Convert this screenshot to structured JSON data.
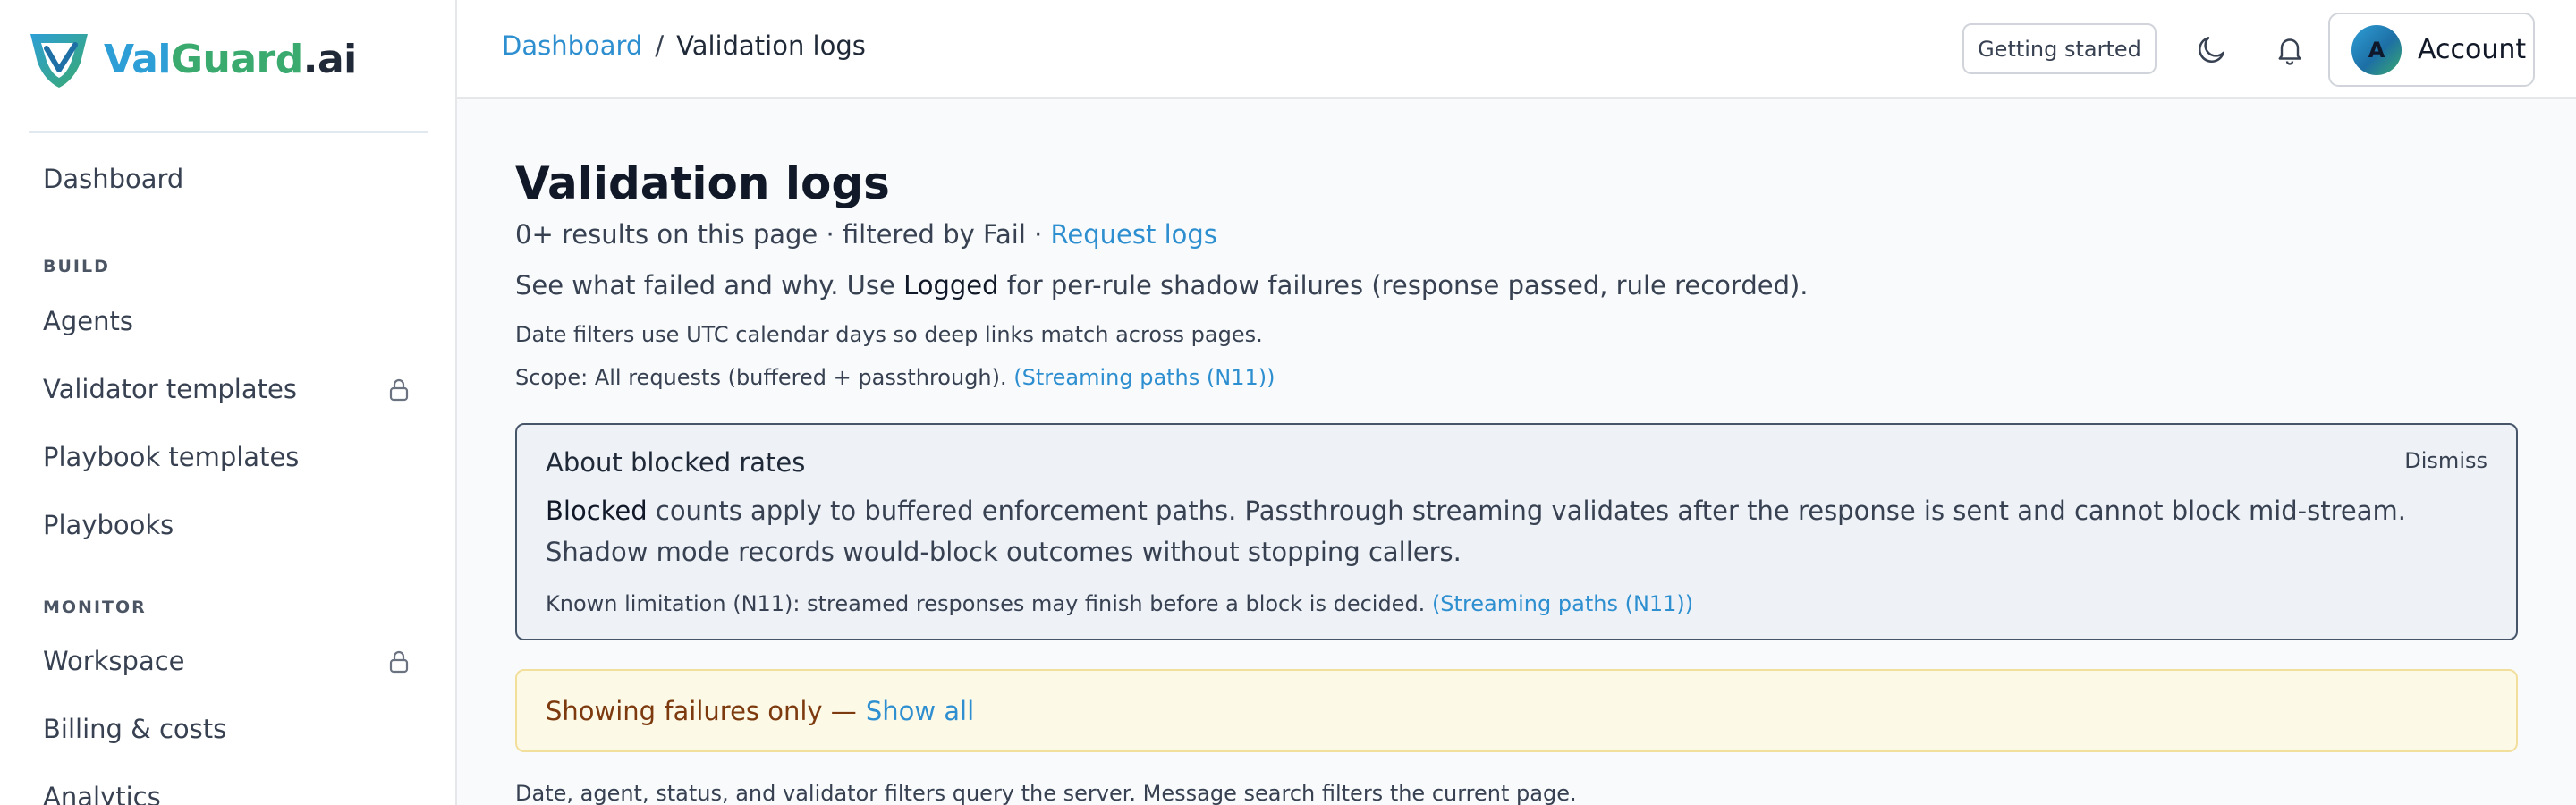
{
  "brand": {
    "name_part1": "Val",
    "name_part2": "Guard",
    "name_part3": ".ai",
    "colors": {
      "primary": "#2e9fd6",
      "secondary": "#3aaa6e"
    }
  },
  "sidebar": {
    "dashboard": "Dashboard",
    "section_build": "BUILD",
    "agents": "Agents",
    "validator_templates": "Validator templates",
    "playbook_templates": "Playbook templates",
    "playbooks": "Playbooks",
    "section_monitor": "MONITOR",
    "workspace": "Workspace",
    "billing": "Billing & costs",
    "analytics": "Analytics",
    "lock_icon": "lock-icon"
  },
  "header": {
    "breadcrumb_parent": "Dashboard",
    "breadcrumb_sep": "/",
    "breadcrumb_current": "Validation logs",
    "getting_started": "Getting started",
    "theme_icon": "moon-icon",
    "notifications_icon": "bell-icon",
    "avatar_initial": "A",
    "account_label": "Account"
  },
  "main": {
    "title": "Validation logs",
    "subline_text": "0+ results on this page · filtered by Fail · ",
    "subline_link": "Request logs",
    "desc_pre": "See what failed and why. Use ",
    "desc_bold": "Logged",
    "desc_post": " for per-rule shadow failures (response passed, rule recorded).",
    "date_note": "Date filters use UTC calendar days so deep links match across pages.",
    "scope_text": "Scope: All requests (buffered + passthrough). ",
    "scope_link": "(Streaming paths (N11))",
    "about": {
      "title": "About blocked rates",
      "dismiss": "Dismiss",
      "body_bold": "Blocked",
      "body_rest": " counts apply to buffered enforcement paths. Passthrough streaming validates after the response is sent and cannot block mid-stream. Shadow mode records would-block outcomes without stopping callers.",
      "note_text": "Known limitation (N11): streamed responses may finish before a block is decided. ",
      "note_link": "(Streaming paths (N11))"
    },
    "failures_banner": {
      "text": "Showing failures only —",
      "link": "Show all"
    },
    "filter_note": "Date, agent, status, and validator filters query the server. Message search filters the current page."
  }
}
